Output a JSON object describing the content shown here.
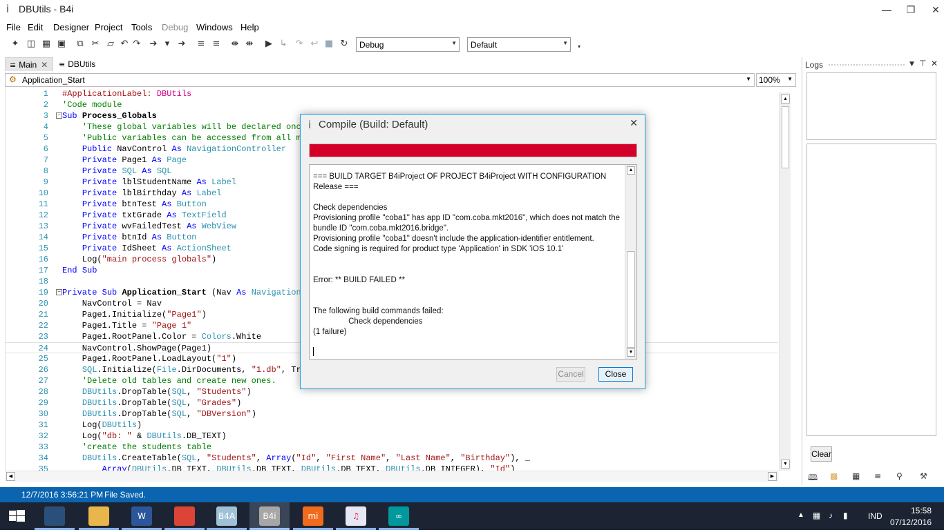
{
  "window": {
    "title": "DBUtils - B4i",
    "app_icon": "i"
  },
  "menu": [
    "File",
    "Edit",
    "Designer",
    "Project",
    "Tools",
    "Debug",
    "Windows",
    "Help"
  ],
  "toolbar": {
    "build_config": "Debug",
    "build_target": "Default"
  },
  "tabs": [
    {
      "label": "Main",
      "active": true
    },
    {
      "label": "DBUtils",
      "active": false
    }
  ],
  "sub_selector": "Application_Start",
  "zoom": "100%",
  "code_lines": [
    {
      "n": "1",
      "t": "#ApplicationLabel: DBUtils"
    },
    {
      "n": "2",
      "t": "'Code module"
    },
    {
      "n": "3",
      "t": "Sub Process_Globals"
    },
    {
      "n": "4",
      "t": "    'These global variables will be declared once"
    },
    {
      "n": "5",
      "t": "    'Public variables can be accessed from all mod"
    },
    {
      "n": "6",
      "t": "    Public NavControl As NavigationController"
    },
    {
      "n": "7",
      "t": "    Private Page1 As Page"
    },
    {
      "n": "8",
      "t": "    Private SQL As SQL"
    },
    {
      "n": "9",
      "t": "    Private lblStudentName As Label"
    },
    {
      "n": "10",
      "t": "    Private lblBirthday As Label"
    },
    {
      "n": "11",
      "t": "    Private btnTest As Button"
    },
    {
      "n": "12",
      "t": "    Private txtGrade As TextField"
    },
    {
      "n": "13",
      "t": "    Private wvFailedTest As WebView"
    },
    {
      "n": "14",
      "t": "    Private btnId As Button"
    },
    {
      "n": "15",
      "t": "    Private IdSheet As ActionSheet"
    },
    {
      "n": "16",
      "t": "    Log(\"main process globals\")"
    },
    {
      "n": "17",
      "t": "End Sub"
    },
    {
      "n": "18",
      "t": ""
    },
    {
      "n": "19",
      "t": "Private Sub Application_Start (Nav As NavigationCo"
    },
    {
      "n": "20",
      "t": "    NavControl = Nav"
    },
    {
      "n": "21",
      "t": "    Page1.Initialize(\"Page1\")"
    },
    {
      "n": "22",
      "t": "    Page1.Title = \"Page 1\""
    },
    {
      "n": "23",
      "t": "    Page1.RootPanel.Color = Colors.White"
    },
    {
      "n": "24",
      "t": "    NavControl.ShowPage(Page1)"
    },
    {
      "n": "25",
      "t": "    Page1.RootPanel.LoadLayout(\"1\")"
    },
    {
      "n": "26",
      "t": "    SQL.Initialize(File.DirDocuments, \"1.db\", Tru"
    },
    {
      "n": "27",
      "t": "    'Delete old tables and create new ones."
    },
    {
      "n": "28",
      "t": "    DBUtils.DropTable(SQL, \"Students\")"
    },
    {
      "n": "29",
      "t": "    DBUtils.DropTable(SQL, \"Grades\")"
    },
    {
      "n": "30",
      "t": "    DBUtils.DropTable(SQL, \"DBVersion\")"
    },
    {
      "n": "31",
      "t": "    Log(DBUtils)"
    },
    {
      "n": "32",
      "t": "    Log(\"db: \" & DBUtils.DB_TEXT)"
    },
    {
      "n": "33",
      "t": "    'create the students table"
    },
    {
      "n": "34",
      "t": "    DBUtils.CreateTable(SQL, \"Students\", Array(\"Id\", \"First Name\", \"Last Name\", \"Birthday\"), _"
    },
    {
      "n": "35",
      "t": "        Array(DBUtils.DB_TEXT, DBUtils.DB_TEXT, DBUtils.DB_TEXT, DBUtils.DB_INTEGER), \"Id\")"
    }
  ],
  "logs": {
    "title": "Logs",
    "clear_label": "Clear"
  },
  "dialog": {
    "title": "Compile (Build: Default)",
    "progress_color": "#d4002a",
    "output_lines": [
      "=== BUILD TARGET B4iProject OF PROJECT B4iProject WITH CONFIGURATION Release ===",
      "",
      "Check dependencies",
      "Provisioning profile \"coba1\" has app ID \"com.coba.mkt2016\", which does not match the bundle ID \"com.coba.mkt2016.bridge\".",
      "Provisioning profile \"coba1\" doesn't include the application-identifier entitlement.",
      "Code signing is required for product type 'Application' in SDK 'iOS 10.1'",
      "",
      "",
      "Error: ** BUILD FAILED **",
      "",
      "",
      "The following build commands failed:",
      "\t\tCheck dependencies",
      "(1 failure)"
    ],
    "cancel_label": "Cancel",
    "close_label": "Close"
  },
  "status": {
    "timestamp": "12/7/2016 3:56:21 PM",
    "message": "File Saved."
  },
  "taskbar": {
    "apps": [
      {
        "name": "transformers-app",
        "glyph": "",
        "color": "#2a4f7a"
      },
      {
        "name": "file-explorer",
        "glyph": "",
        "color": "#e8b64a"
      },
      {
        "name": "word",
        "glyph": "W",
        "color": "#2b579a"
      },
      {
        "name": "chrome",
        "glyph": "",
        "color": "#db4437"
      },
      {
        "name": "b4a",
        "glyph": "B4A",
        "color": "#9fc1d6"
      },
      {
        "name": "b4i",
        "glyph": "B4i",
        "color": "#a7a7a7"
      },
      {
        "name": "mi",
        "glyph": "mi",
        "color": "#f26b1d"
      },
      {
        "name": "itunes",
        "glyph": "♫",
        "color": "#e8e8f4"
      },
      {
        "name": "arduino",
        "glyph": "∞",
        "color": "#00979d"
      }
    ],
    "language": "IND",
    "time": "15:58",
    "date": "07/12/2016"
  }
}
